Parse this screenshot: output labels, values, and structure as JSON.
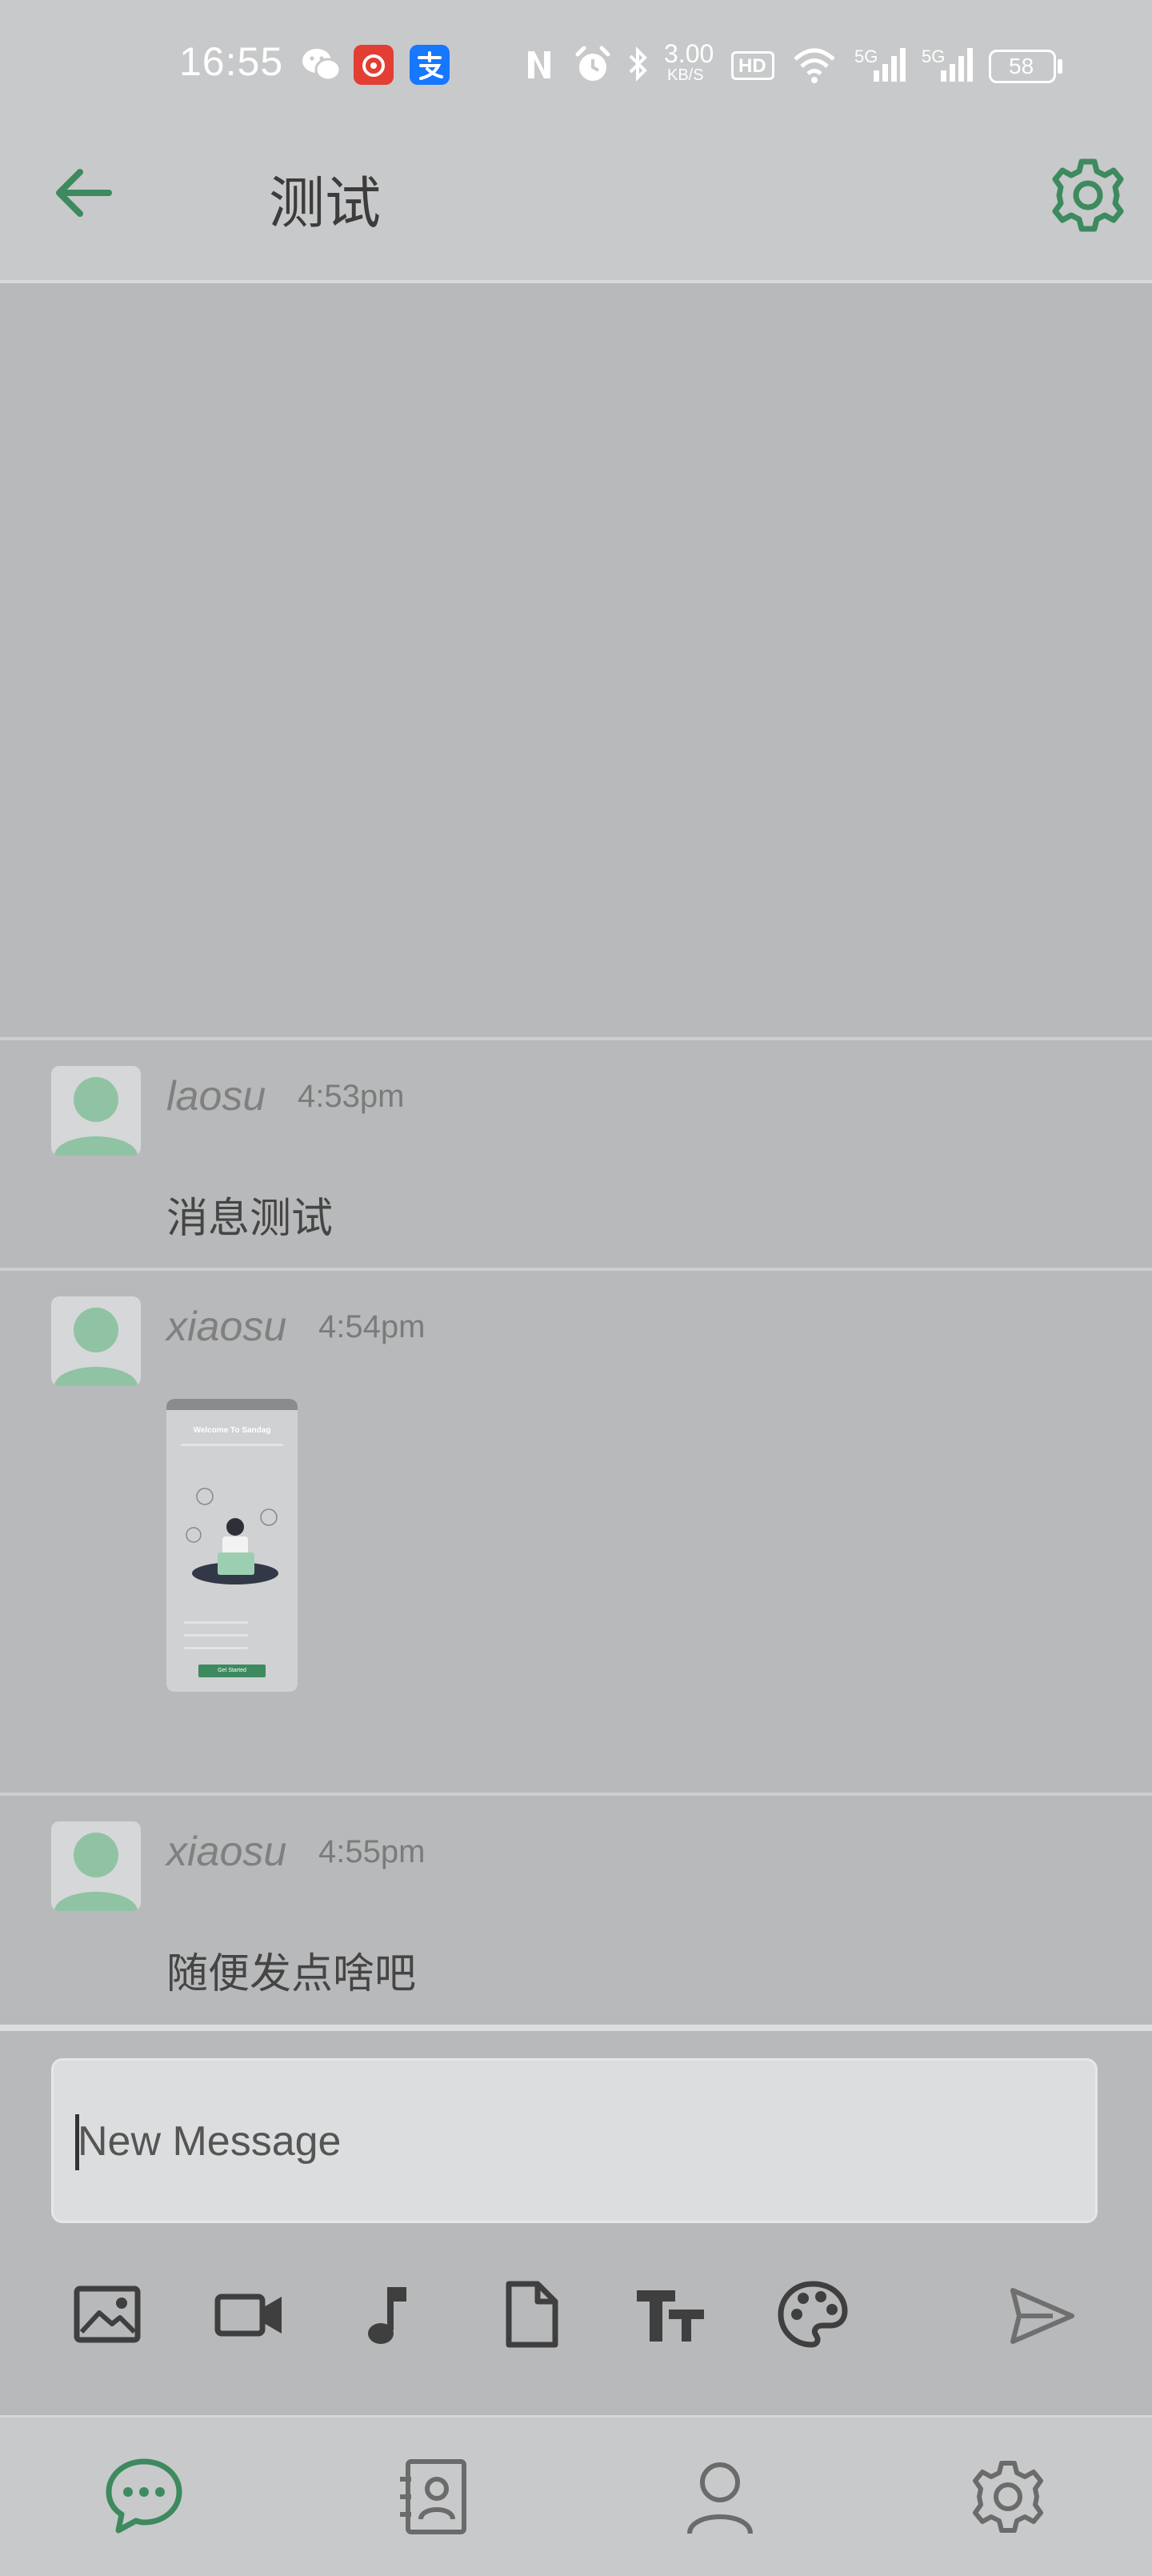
{
  "status_bar": {
    "time": "16:55",
    "net_speed_value": "3.00",
    "net_speed_unit": "KB/S",
    "hd_badge": "HD",
    "signal1": "5G",
    "signal2": "5G",
    "battery": "58"
  },
  "header": {
    "title": "测试"
  },
  "messages": [
    {
      "author": "laosu",
      "time": "4:53pm",
      "text": "消息测试"
    },
    {
      "author": "xiaosu",
      "time": "4:54pm",
      "image_preview_title": "Welcome To Sandag",
      "image_preview_button": "Get Started"
    },
    {
      "author": "xiaosu",
      "time": "4:55pm",
      "text": "随便发点啥吧"
    }
  ],
  "composer": {
    "placeholder": "New Message"
  },
  "toolbar": [
    "image-icon",
    "video-icon",
    "music-note-icon",
    "file-icon",
    "text-format-icon",
    "palette-icon",
    "send-icon"
  ],
  "bottom_nav": [
    "chats-icon",
    "contacts-icon",
    "profile-icon",
    "settings-icon"
  ],
  "colors": {
    "accent": "#3d8a5f",
    "background": "#b8b9ba",
    "bar": "#c8c9ca",
    "avatar_green": "#8fc3a3"
  }
}
